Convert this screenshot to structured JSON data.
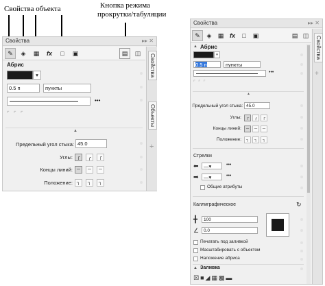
{
  "annotations": {
    "object_properties": "Свойства объекта",
    "scroll_tab_mode_line1": "Кнопка режима",
    "scroll_tab_mode_line2": "прокрутки/табуляции"
  },
  "left_panel": {
    "title": "Свойства",
    "title_controls": "▸▸ ✕",
    "tabs": [
      "Свойства",
      "Объекты"
    ],
    "section": "Абрис",
    "width_value": "0.5 п",
    "units_value": "пункты",
    "more": "•••",
    "miter_label": "Предельный угол стыка:",
    "miter_value": "45.0",
    "corners_label": "Углы:",
    "caps_label": "Концы линий:",
    "position_label": "Положение:"
  },
  "right_panel": {
    "title": "Свойства",
    "tab": "Свойства",
    "section": "Абрис",
    "width_value": "0.5 п",
    "units_value": "пункты",
    "more": "•••",
    "miter_label": "Предельный угол стыка:",
    "miter_value": "45.0",
    "corners_label": "Углы:",
    "caps_label": "Концы линий:",
    "position_label": "Положение:",
    "arrows_label": "Стрелки",
    "shared_attrs": "Общие атрибуты",
    "calligraphic_label": "Каллиграфическое",
    "stretch_value": "100",
    "angle_value": "0.0",
    "print_under_fill": "Печатать под заливкой",
    "scale_with_object": "Масштабировать с объектом",
    "overlay_outline": "Наложение абриса",
    "fill_section": "Заливка"
  },
  "colors": {
    "outline_swatch": "#1a1a1a",
    "panel_bg": "#f0f0f0",
    "selection": "#3377dd"
  }
}
